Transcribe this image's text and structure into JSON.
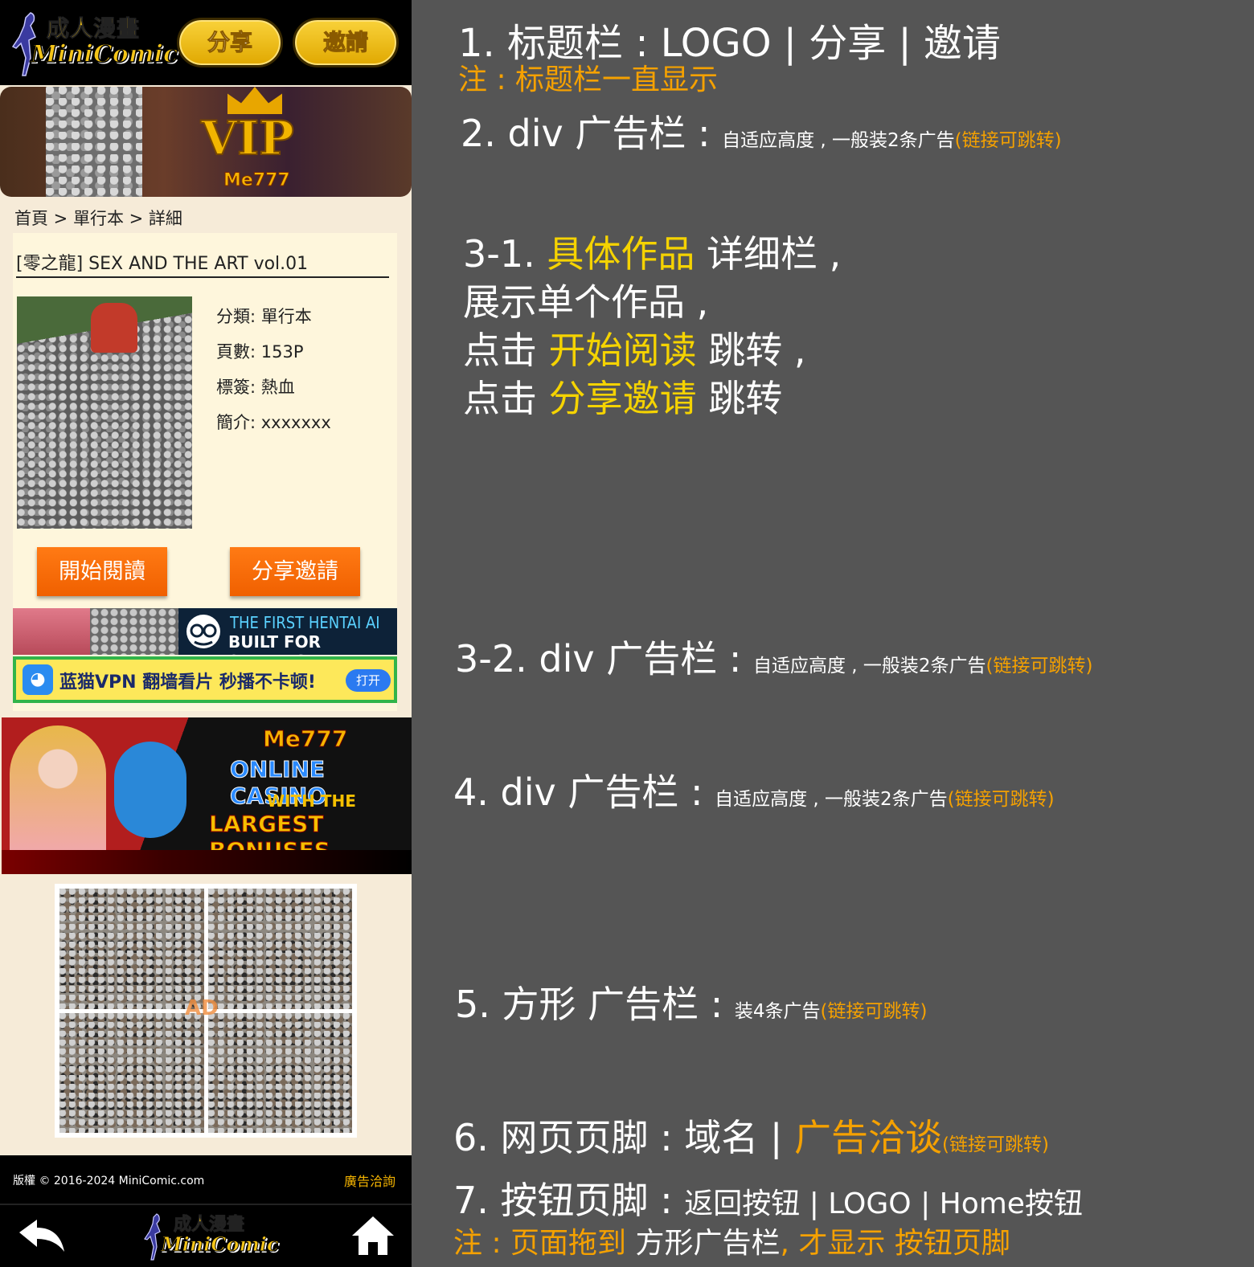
{
  "header": {
    "logo_cn": "成人漫畫",
    "logo_en": "MiniComic",
    "share_label": "分享",
    "invite_label": "邀請"
  },
  "ad_top": {
    "vip_text": "VIP",
    "brand": "Me777"
  },
  "breadcrumb": "首頁 > 單行本 > 詳細",
  "work": {
    "title": "[零之龍] SEX AND THE ART vol.01",
    "category": "分類:  單行本",
    "pages": "頁數:  153P",
    "tags": "標簽:  熱血",
    "summary": "簡介:  xxxxxxx",
    "read_label": "開始閱讀",
    "share_invite_label": "分享邀請"
  },
  "ad_mid": {
    "ai_line1": "THE FIRST HENTAI AI",
    "ai_line2": "BUILT FOR SEXTING",
    "vpn_text": "蓝猫VPN 翻墙看片 秒播不卡顿!",
    "vpn_open": "打开"
  },
  "ad_casino": {
    "brand": "Me777",
    "line1": "ONLINE CASINO",
    "line2": "WITH THE",
    "line3": "LARGEST BONUSES"
  },
  "square_ad_mark": "AD",
  "footer": {
    "copyright": "版權 © 2016-2024 MiniComic.com",
    "ad_inquiry": "廣告洽詢"
  },
  "bottom_nav": {
    "logo_cn": "成人漫畫",
    "logo_en": "MiniComic"
  },
  "notes": {
    "n1": "1. 标题栏 :  LOGO | 分享 | 邀请",
    "n1_sub": "注 :  标题栏一直显示",
    "n2_main": "2. div 广告栏 :",
    "n2_small": "自适应高度 ,  一般装2条广告",
    "link_hint": "(链接可跳转)",
    "n31_a": "3-1.",
    "n31_b": "具体作品",
    "n31_c": "详细栏 ,",
    "n31_d": "展示单个作品 ,",
    "n31_e": "点击",
    "n31_f": "开始阅读",
    "n31_g": "跳转 ,",
    "n31_h": "点击",
    "n31_i": "分享邀请",
    "n31_j": "跳转",
    "n32_main": "3-2. div 广告栏 :",
    "n4_main": "4. div 广告栏 :",
    "n5_main": "5. 方形 广告栏 :",
    "n5_small": "装4条广告",
    "n6_main": "6. 网页页脚 :  域名 |",
    "n6_orange": "广告洽谈",
    "n7_main": "7. 按钮页脚 :",
    "n7_items": "返回按钮 | LOGO | Home按钮",
    "n7_sub_a": "注 :  页面拖到",
    "n7_sub_b": "方形广告栏",
    "n7_sub_c": ",  才显示 按钮页脚"
  }
}
